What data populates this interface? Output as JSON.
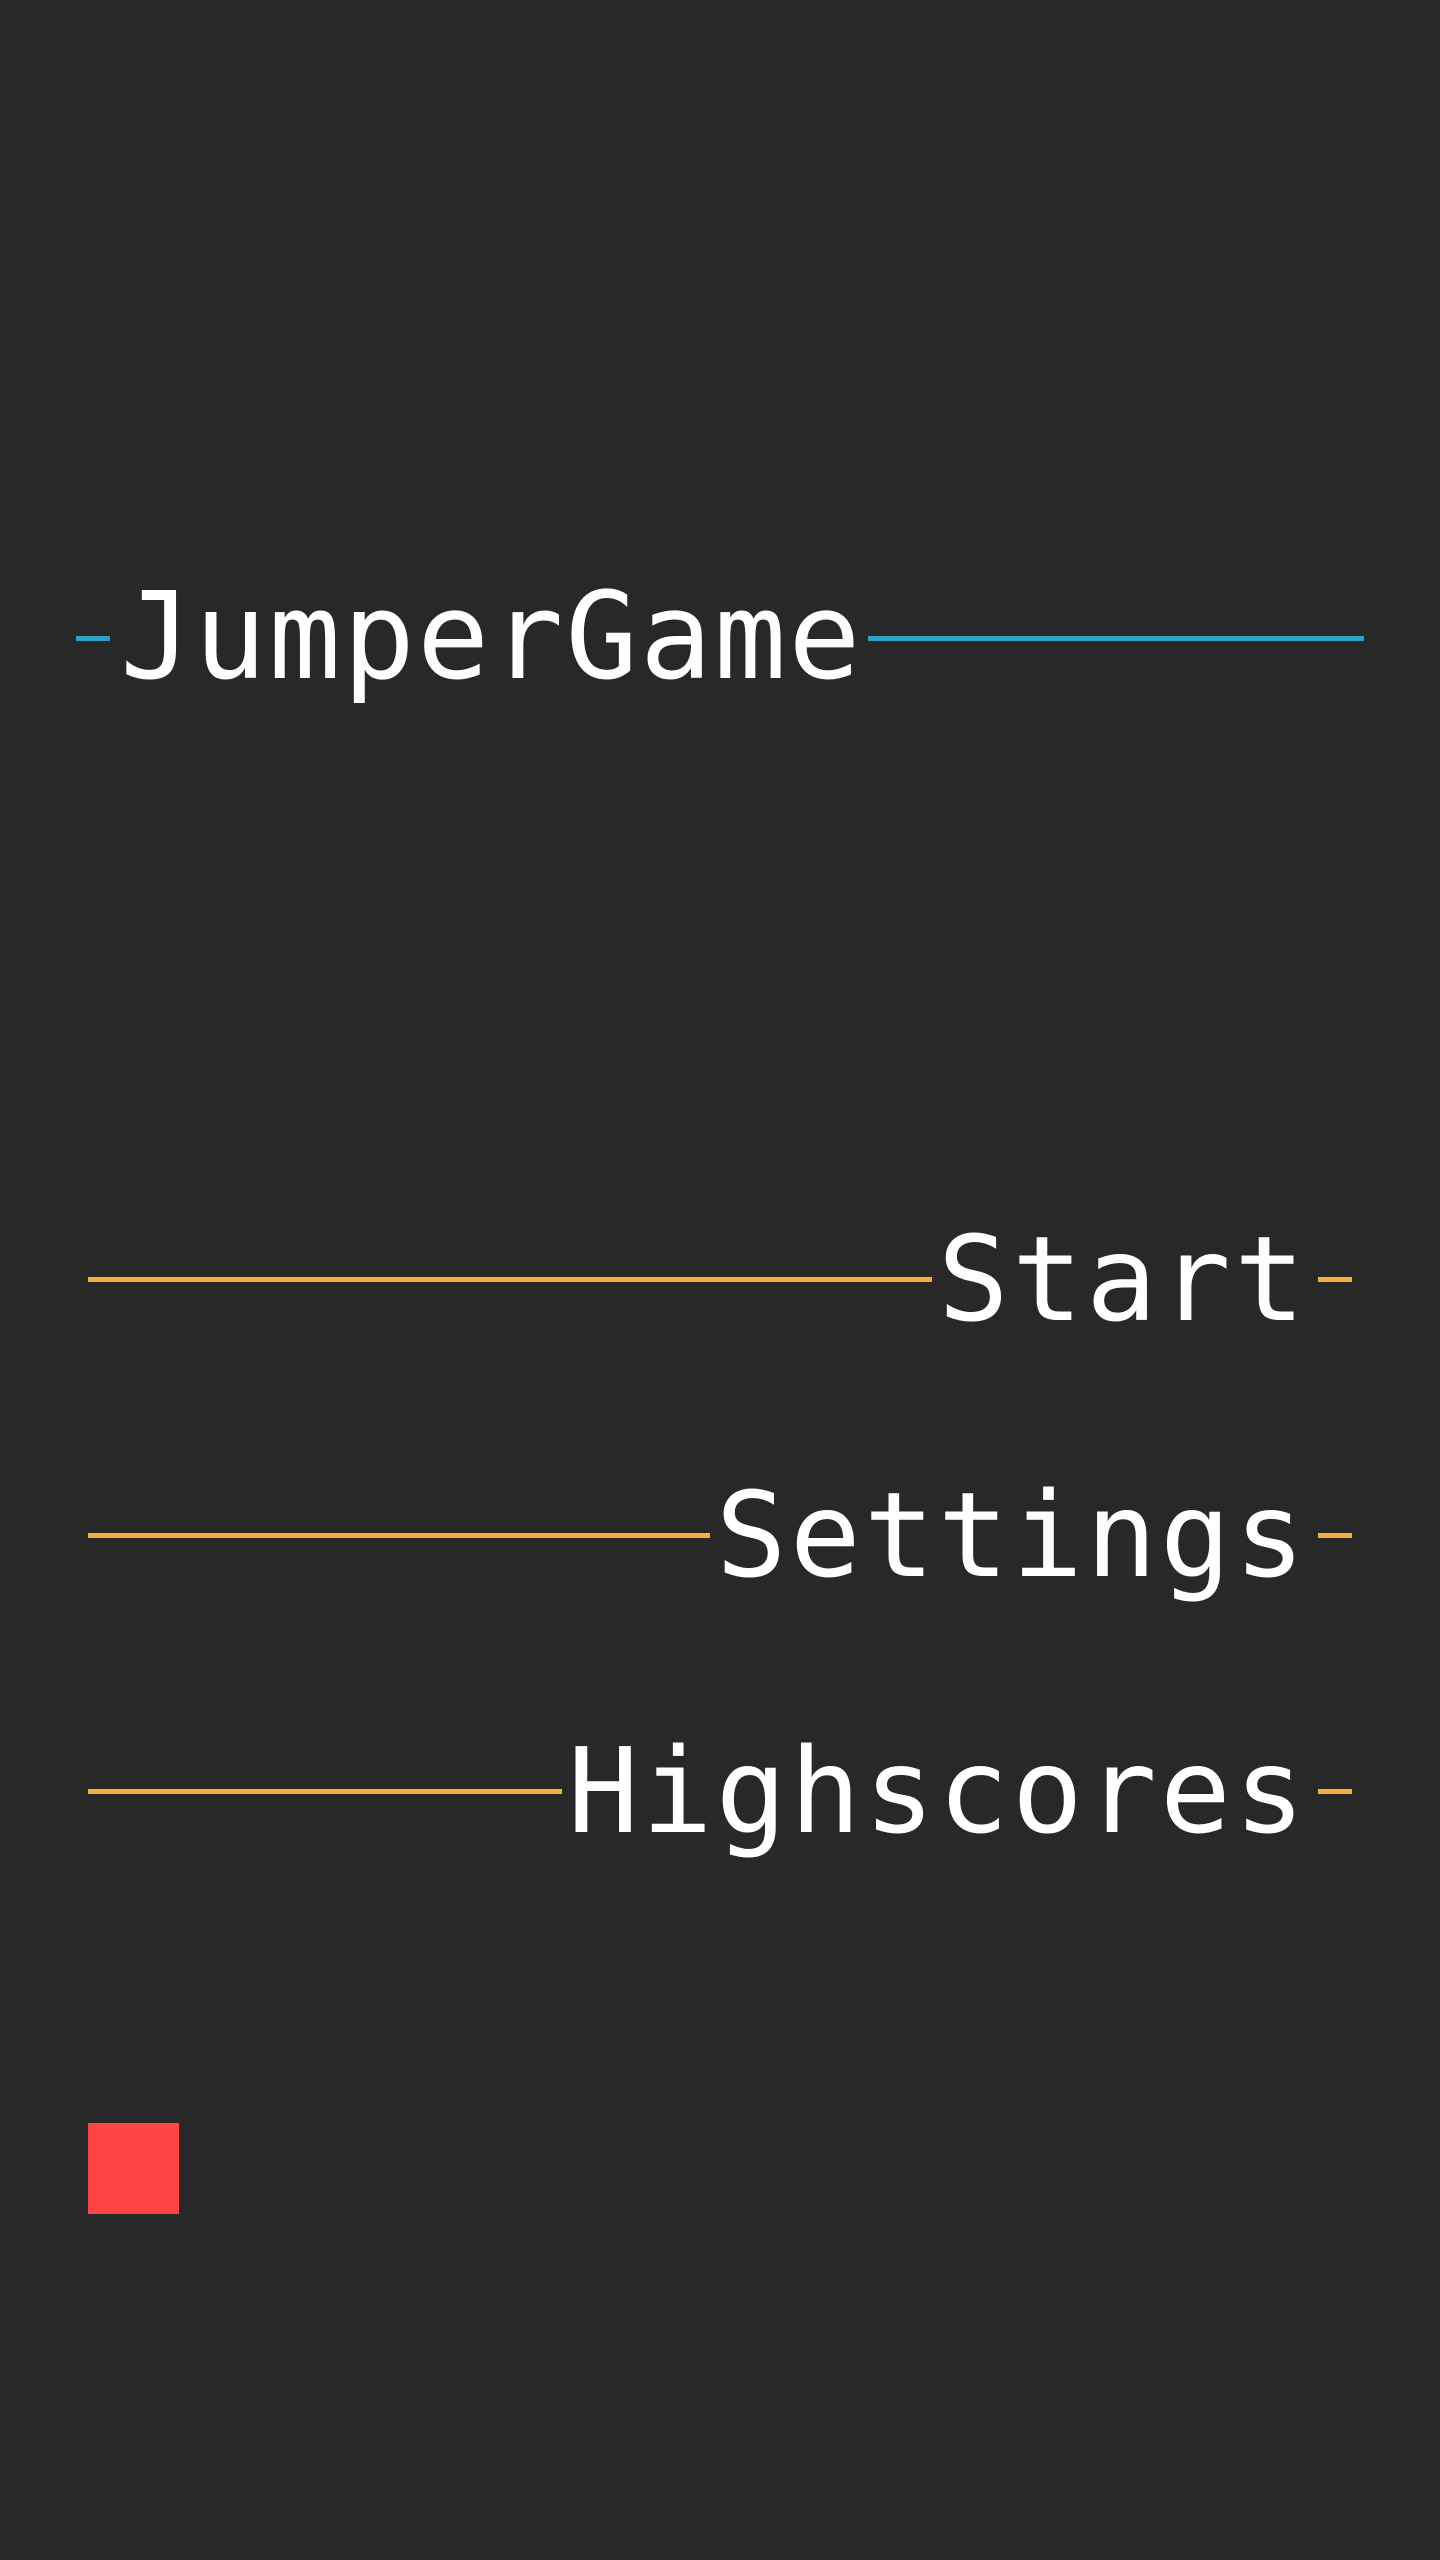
{
  "game": {
    "title": "JumperGame"
  },
  "menu": {
    "items": [
      {
        "label": "Start"
      },
      {
        "label": "Settings"
      },
      {
        "label": "Highscores"
      }
    ]
  },
  "colors": {
    "background": "#282828",
    "title_accent": "#29a3c9",
    "menu_accent": "#f2b233",
    "text": "#ffffff",
    "player": "#ff4444"
  },
  "icons": {
    "player": "player-square-icon"
  }
}
